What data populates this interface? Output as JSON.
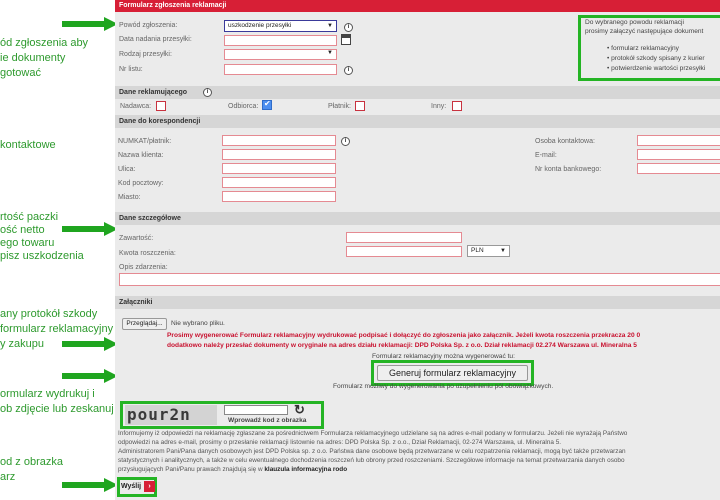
{
  "annotations": {
    "note1_line1": "ód zgłoszenia aby",
    "note1_line2": "ie dokumenty",
    "note1_line3": "gotować",
    "note2": "kontaktowe",
    "note3_line1": "rtość paczki",
    "note3_line2": "ość netto",
    "note3_line3": "ego towaru",
    "note3_line4": "pisz uszkodzenia",
    "note4_line1": "any protokół szkody",
    "note4_line2": "formularz reklamacyjny",
    "note4_line3": "y zakupu",
    "note5_line1": "ormularz wydrukuj i",
    "note5_line2": "ob zdjęcie lub zeskanuj",
    "note6_line1": "od z obrazka",
    "note6_line2": "arz"
  },
  "form": {
    "title": "Formularz zgłoszenia reklamacji",
    "reason_label": "Powód zgłoszenia:",
    "reason_value": "uszkodzenie przesyłki",
    "send_date_label": "Data nadania przesyłki:",
    "parcel_type_label": "Rodzaj przesyłki:",
    "waybill_label": "Nr listu:",
    "notice": {
      "line1": "Do wybranego powodu reklamacji",
      "line2": "prosimy załączyć następujące dokument",
      "items": [
        "formularz reklamacyjny",
        "protokół szkody spisany z kurier",
        "potwierdzenie wartości przesyłki"
      ]
    },
    "claimant": {
      "title": "Dane reklamującego",
      "sender": "Nadawca:",
      "recipient": "Odbiorca:",
      "payer": "Płatnik:",
      "other": "Inny:"
    },
    "correspondence": {
      "title": "Dane do korespondencji",
      "numkat": "NUMKAT/płatnik:",
      "client_name": "Nazwa klienta:",
      "street": "Ulica:",
      "postal": "Kod pocztowy:",
      "city": "Miasto:",
      "contact": "Osoba kontaktowa:",
      "email": "E-mail:",
      "bank": "Nr konta bankowego:"
    },
    "details": {
      "title": "Dane szczegółowe",
      "content": "Zawartość:",
      "amount": "Kwota roszczenia:",
      "currency": "PLN",
      "description": "Opis zdarzenia:"
    },
    "attachments": {
      "title": "Załączniki",
      "browse": "Przeglądaj...",
      "no_file": "Nie wybrano pliku.",
      "warning1": "Prosimy wygenerować Formularz reklamacyjny wydrukować podpisać i dołączyć do zgłoszenia jako załącznik. Jeżeli kwota roszczenia przekracza 20 0",
      "warning2": "dodatkowo należy przesłać dokumenty w oryginale na adres działu reklamacji: DPD Polska Sp. z o.o. Dział reklamacji 02.274 Warszawa ul. Mineralna 5"
    },
    "generate": {
      "hint": "Formularz reklamacyjny można wygenerować tu:",
      "button": "Generuj formularz reklamacyjny",
      "note": "Formularz możliwy do wygenerowania po uzupełnieniu pól obowiązkowych."
    },
    "captcha": {
      "image_text": "pour2n",
      "label": "Wprowadź kod z obrazka",
      "refresh_icon": "refresh-icon"
    },
    "legal": {
      "line1": "Informujemy iż odpowiedzi na reklamację zgłaszane za pośrednictwem Formularza reklamacyjnego udzielane są na adres e-mail podany w formularzu. Jeżeli nie wyrażają Państwo",
      "line2": "odpowiedzi na adres e-mail, prosimy o przesłanie reklamacji listownie na adres: DPD Polska Sp. z o.o., Dział Reklamacji, 02-274 Warszawa, ul. Mineralna 5.",
      "line3": "Administratorem Pani/Pana danych osobowych jest DPD Polska sp. z o.o. Państwa dane osobowe będą przetwarzane w celu rozpatrzenia reklamacji, mogą być także przetwarzan",
      "line4": "statystycznych i analitycznych, a także w celu ewentualnego dochodzenia roszczeń lub obrony przed roszczeniami. Szczegółowe informacje na temat przetwarzania danych osobo",
      "line5_pre": "przysługujących Pani/Panu prawach znajdują się w ",
      "line5_link": "klauzula informacyjna rodo"
    },
    "send_button": "Wyślij"
  },
  "colors": {
    "accent": "#d71f36",
    "annotation": "#1fa51f"
  }
}
